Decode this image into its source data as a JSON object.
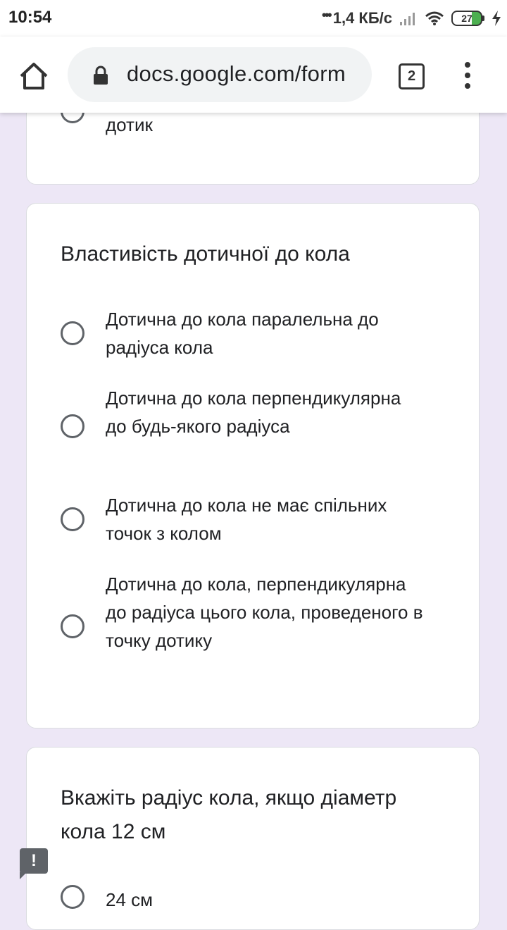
{
  "status_bar": {
    "time": "10:54",
    "network_speed": "1,4 КБ/с",
    "battery_level": "27",
    "icons": [
      "signal-icon",
      "wifi-icon",
      "battery-icon",
      "charging-icon"
    ]
  },
  "browser": {
    "url": "docs.google.com/form",
    "tab_count": "2",
    "icons": [
      "home-icon",
      "lock-icon",
      "tabs-icon",
      "more-vert-icon"
    ]
  },
  "form": {
    "prev_card_tail": "дотик",
    "question1": {
      "title": "Властивість дотичної до кола",
      "options": [
        "Дотична до кола паралельна до радіуса кола",
        "Дотична до кола перпендикулярна до будь-якого радіуса",
        "Дотична до кола не має спільних точок з колом",
        "Дотична до кола, перпендикулярна до радіуса цього кола, проведеного в точку дотику"
      ]
    },
    "question2": {
      "title": "Вкажіть радіус кола, якщо діаметр кола 12 см",
      "options": [
        "24 см"
      ]
    },
    "report_icon_label": "!"
  },
  "colors": {
    "page_background": "#ede7f6",
    "radio_border": "#5f6368",
    "card_border": "#dadce0"
  }
}
